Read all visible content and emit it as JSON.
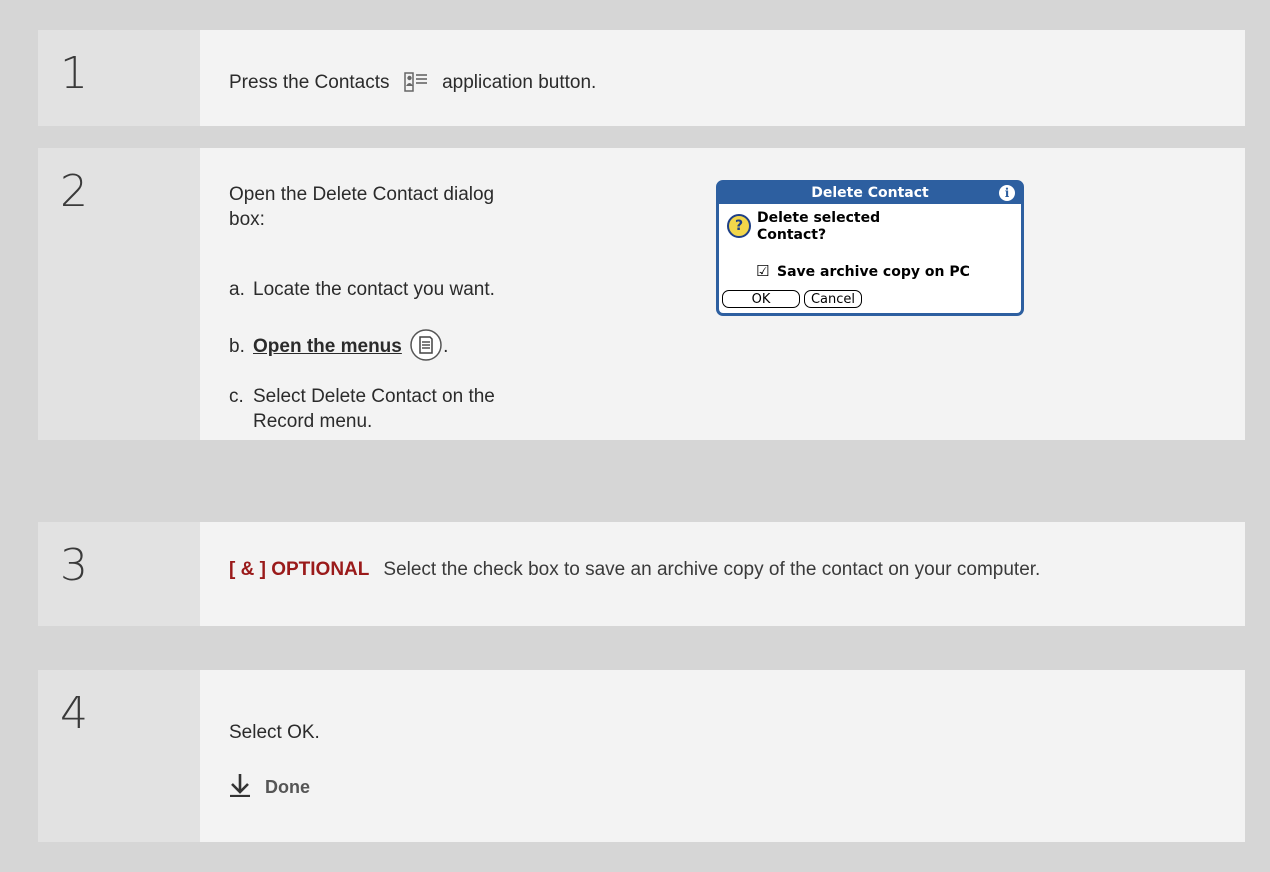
{
  "steps": [
    {
      "number": "1"
    },
    {
      "number": "2"
    },
    {
      "number": "3"
    },
    {
      "number": "4"
    }
  ],
  "step1": {
    "before": "Press the Contacts",
    "after": "application button.",
    "icon": "contacts-app-icon"
  },
  "step2": {
    "intro": "Open the Delete Contact dialog box:",
    "a_letter": "a.",
    "a_text": "Locate the contact you want.",
    "b_letter": "b.",
    "b_link": "Open the menus",
    "b_after": ".",
    "c_letter": "c.",
    "c_line1": "Select Delete Contact on the",
    "c_line2": "Record menu.",
    "menu_icon": "menu-button-icon"
  },
  "dialog": {
    "title": "Delete Contact",
    "info_icon": "i",
    "question_icon": "?",
    "message_line1": "Delete selected",
    "message_line2": "Contact?",
    "checkbox_label": "Save archive copy on PC",
    "checkbox_checked": true,
    "ok_label": "OK",
    "cancel_label": "Cancel",
    "accent_color": "#2d5fa0"
  },
  "step3": {
    "tag": "[ & ]  OPTIONAL",
    "text": "Select the check box to save an archive copy of the contact on your computer.",
    "tag_color": "#9a1a1a"
  },
  "step4": {
    "text": "Select OK.",
    "done_label": "Done",
    "done_icon": "down-arrow-icon"
  }
}
